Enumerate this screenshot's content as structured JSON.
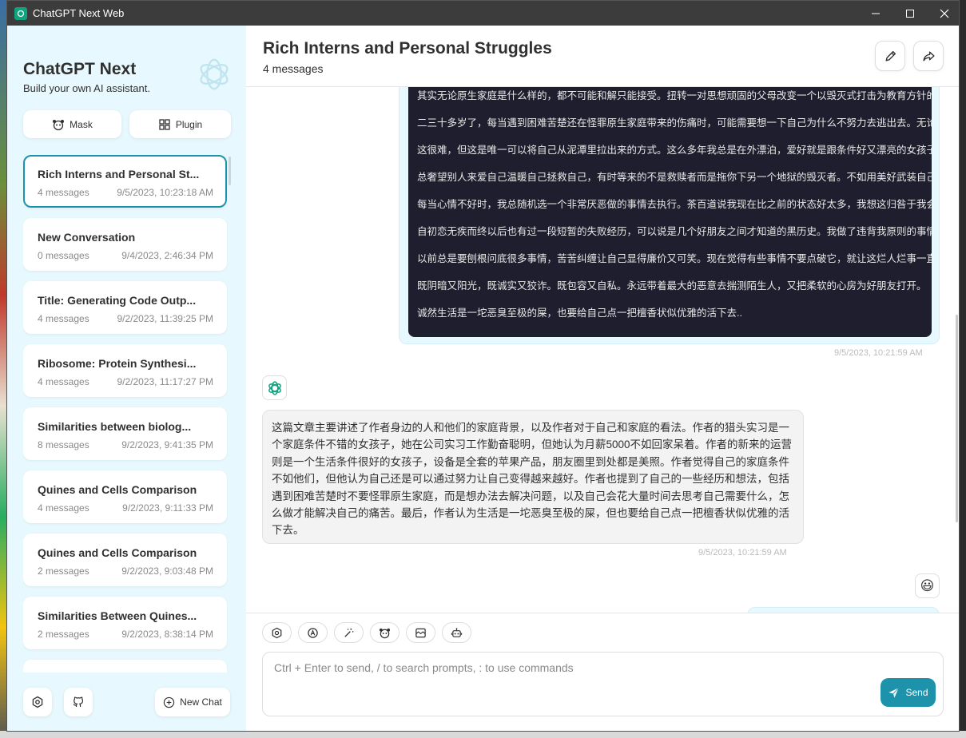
{
  "window": {
    "title": "ChatGPT Next Web"
  },
  "sidebar": {
    "title": "ChatGPT Next",
    "subtitle": "Build your own AI assistant.",
    "mask_label": "Mask",
    "plugin_label": "Plugin",
    "new_chat_label": "New Chat",
    "chats": [
      {
        "title": "Rich Interns and Personal St...",
        "count": "4 messages",
        "date": "9/5/2023, 10:23:18 AM"
      },
      {
        "title": "New Conversation",
        "count": "0 messages",
        "date": "9/4/2023, 2:46:34 PM"
      },
      {
        "title": "Title: Generating Code Outp...",
        "count": "4 messages",
        "date": "9/2/2023, 11:39:25 PM"
      },
      {
        "title": "Ribosome: Protein Synthesi...",
        "count": "4 messages",
        "date": "9/2/2023, 11:17:27 PM"
      },
      {
        "title": "Similarities between biolog...",
        "count": "8 messages",
        "date": "9/2/2023, 9:41:35 PM"
      },
      {
        "title": "Quines and Cells Comparison",
        "count": "4 messages",
        "date": "9/2/2023, 9:11:33 PM"
      },
      {
        "title": "Quines and Cells Comparison",
        "count": "2 messages",
        "date": "9/2/2023, 9:03:48 PM"
      },
      {
        "title": "Similarities Between Quines...",
        "count": "2 messages",
        "date": "9/2/2023, 8:38:14 PM"
      },
      {
        "title": "",
        "count": "",
        "date": ""
      }
    ]
  },
  "chat": {
    "title": "Rich Interns and Personal Struggles",
    "subtitle": "4 messages",
    "code_lines": [
      "其实无论原生家庭是什么样的，都不可能和解只能接受。扭转一对思想顽固的父母改变一个以毁灭式打击为教育方针的家庭",
      "二三十多岁了，每当遇到困难苦楚还在怪罪原生家庭带来的伤痛时，可能需要想一下自己为什么不努力去逃出去。无论是离",
      "这很难，但这是唯一可以将自己从泥潭里拉出来的方式。这么多年我总是在外漂泊，爱好就是跟条件好又漂亮的女孩子一起",
      "总奢望别人来爱自己温暖自己拯救自己，有时等来的不是救赎者而是拖你下另一个地狱的毁灭者。不如用美好武装自己做个",
      "每当心情不好时，我总随机选一个非常厌恶做的事情去执行。茶百道说我现在比之前的状态好太多，我想这归咎于我会花大",
      "自初恋无疾而终以后也有过一段短暂的失败经历，可以说是几个好朋友之间才知道的黑历史。我做了违背我原则的事情，一",
      "以前总是要刨根问底很多事情，苦苦纠缠让自己显得廉价又可笑。现在觉得有些事情不要点破它，就让这烂人烂事一直烂下",
      "既阴暗又阳光，既诚实又狡诈。既包容又自私。永远带着最大的恶意去揣测陌生人，又把柔软的心房为好朋友打开。",
      "诚然生活是一坨恶臭至极的屎，也要给自己点一把檀香状似优雅的活下去.."
    ],
    "user_date": "9/5/2023, 10:21:59 AM",
    "bot_text": "这篇文章主要讲述了作者身边的人和他们的家庭背景，以及作者对于自己和家庭的看法。作者的猎头实习是一个家庭条件不错的女孩子，她在公司实习工作勤奋聪明，但她认为月薪5000不如回家呆着。作者的新来的运营则是一个生活条件很好的女孩子，设备是全套的苹果产品，朋友圈里到处都是美照。作者觉得自己的家庭条件不如他们，但他认为自己还是可以通过努力让自己变得越来越好。作者也提到了自己的一些经历和想法，包括遇到困难苦楚时不要怪罪原生家庭，而是想办法去解决问题，以及自己会花大量时间去思考自己需要什么，怎么做才能解决自己的痛苦。最后，作者认为生活是一坨恶臭至极的屎，但也要给自己点一把檀香状似优雅的活下去。",
    "bot_date": "9/5/2023, 10:21:59 AM",
    "user_avatar": "😃"
  },
  "input": {
    "placeholder": "Ctrl + Enter to send, / to search prompts, : to use commands",
    "send_label": "Send"
  },
  "colors": {
    "accent": "#1d93ab",
    "sidebar_bg": "#e7f8ff",
    "code_bg": "#1e1e2e"
  }
}
